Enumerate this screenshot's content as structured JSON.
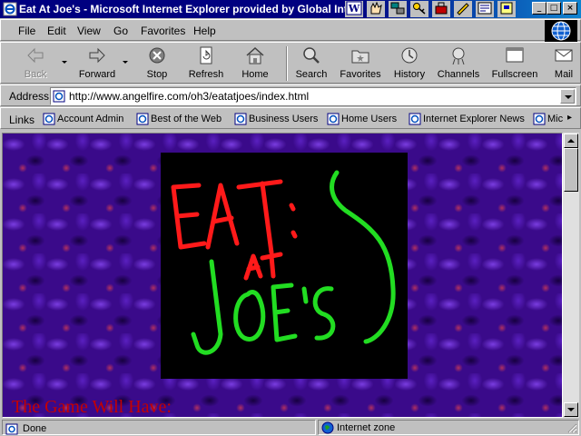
{
  "window": {
    "title": "Eat At Joe's - Microsoft Internet Explorer provided by Global Internet",
    "controls": {
      "minimize": "_",
      "maximize": "□",
      "close": "×"
    }
  },
  "menu": [
    "File",
    "Edit",
    "View",
    "Go",
    "Favorites",
    "Help"
  ],
  "toolbar": {
    "back": "Back",
    "forward": "Forward",
    "stop": "Stop",
    "refresh": "Refresh",
    "home": "Home",
    "search": "Search",
    "favorites": "Favorites",
    "history": "History",
    "channels": "Channels",
    "fullscreen": "Fullscreen",
    "mail": "Mail"
  },
  "address": {
    "label": "Address",
    "url": "http://www.angelfire.com/oh3/eatatjoes/index.html"
  },
  "links": {
    "label": "Links",
    "items": [
      "Account Admin",
      "Best of the Web",
      "Business Users",
      "Home Users",
      "Internet Explorer News",
      "Mic"
    ],
    "more": "▸"
  },
  "page": {
    "logo_text": "EAT AT JOE'S",
    "heading": "The Game Will Have:"
  },
  "status": {
    "text": "Done",
    "zone": "Internet zone"
  },
  "colors": {
    "title_bar": "#000080",
    "page_background": "#3a0a8a",
    "logo_red": "#ff1a1a",
    "logo_green": "#22dd22",
    "heading_red": "#c40000"
  }
}
